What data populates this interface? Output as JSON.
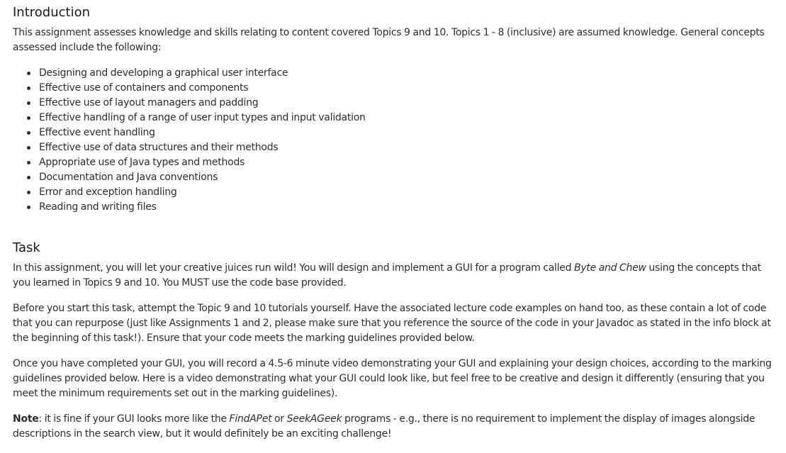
{
  "introduction": {
    "heading": "Introduction",
    "paragraph": "This assignment assesses knowledge and skills relating to content covered Topics 9 and 10. Topics 1 - 8 (inclusive) are assumed knowledge. General concepts assessed include the following:",
    "items": [
      "Designing and developing a graphical user interface",
      "Effective use of containers and components",
      "Effective use of layout managers and padding",
      "Effective handling of a range of user input types and input validation",
      "Effective event handling",
      "Effective use of data structures and their methods",
      "Appropriate use of Java types and methods",
      "Documentation and Java conventions",
      "Error and exception handling",
      "Reading and writing files"
    ]
  },
  "task": {
    "heading": "Task",
    "p1": {
      "before": "In this assignment, you will let your creative juices run wild! You will design and implement a GUI for a program called ",
      "program_name": "Byte and Chew",
      "after": " using the concepts that you learned in Topics 9 and 10. You MUST use the code base provided."
    },
    "p2": "Before you start this task, attempt the Topic 9 and 10 tutorials yourself. Have the associated lecture code examples on hand too, as these contain a lot of code that you can repurpose (just like Assignments 1 and 2, please make sure that you reference the source of the code in your Javadoc as stated in the info block at the beginning of this task!). Ensure that your code meets the marking guidelines provided below.",
    "p3": "Once you have completed your GUI, you will record a 4.5-6 minute video demonstrating your GUI and explaining your design choices, according to the marking guidelines provided below. Here is a video demonstrating what your GUI could look like, but feel free to be creative and design it differently (ensuring that you meet the minimum requirements set out in the marking guidelines).",
    "note": {
      "label": "Note",
      "text1": ": it is fine if your GUI looks more like the ",
      "program1": "FindAPet",
      "text2": " or ",
      "program2": "SeekAGeek",
      "text3": " programs - e.g., there is no requirement to implement the display of images alongside descriptions in the search view, but it would definitely be an exciting challenge!"
    }
  }
}
